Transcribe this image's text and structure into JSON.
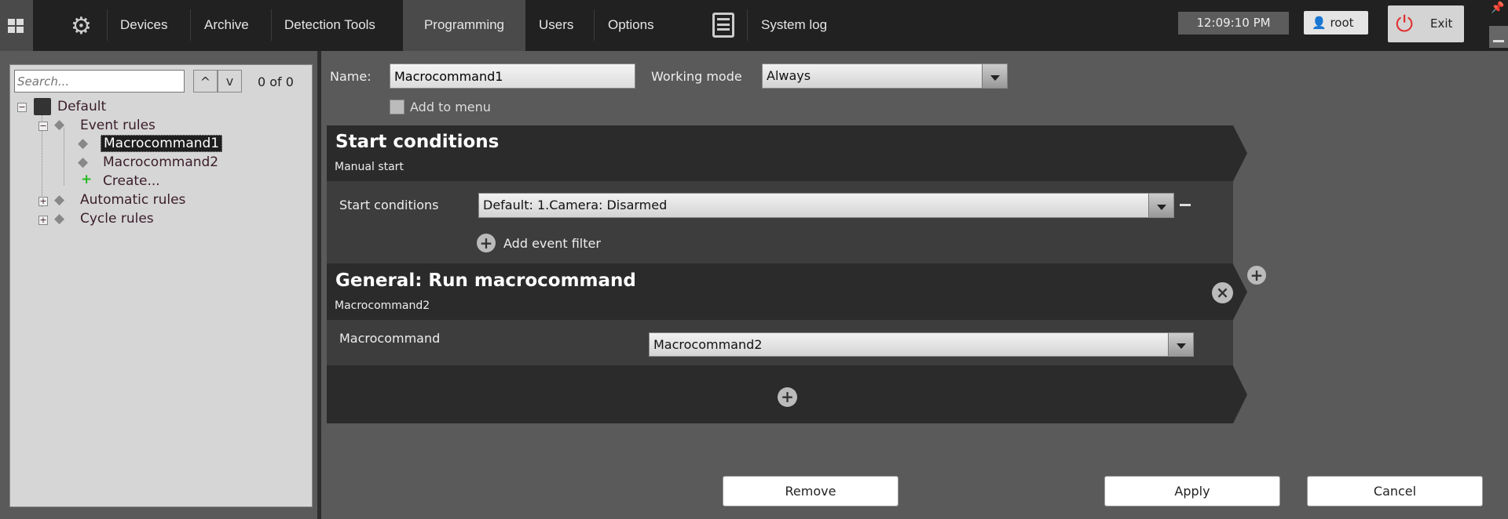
{
  "topbar": {
    "nav": [
      "Devices",
      "Archive",
      "Detection Tools",
      "Programming",
      "Users",
      "Options"
    ],
    "active": "Programming",
    "system_log": "System log",
    "clock": "12:09:10 PM",
    "user": "root",
    "exit": "Exit"
  },
  "tree": {
    "search_placeholder": "Search...",
    "counter": "0 of 0",
    "root": "Default",
    "event_rules": "Event rules",
    "items": [
      "Macrocommand1",
      "Macrocommand2"
    ],
    "create": "Create...",
    "automatic_rules": "Automatic rules",
    "cycle_rules": "Cycle rules"
  },
  "form": {
    "name_label": "Name:",
    "name_value": "Macrocommand1",
    "working_mode_label": "Working mode",
    "working_mode_value": "Always",
    "add_to_menu": "Add to menu"
  },
  "start": {
    "title": "Start conditions",
    "subtitle": "Manual start",
    "row_label": "Start conditions",
    "row_value": "Default: 1.Camera: Disarmed",
    "add_filter": "Add event filter"
  },
  "action": {
    "title": "General: Run macrocommand",
    "subtitle": "Macrocommand2",
    "row_label": "Macrocommand",
    "row_value": "Macrocommand2"
  },
  "buttons": {
    "remove": "Remove",
    "apply": "Apply",
    "cancel": "Cancel"
  },
  "colors": {
    "exit_icon": "#e03030",
    "create_plus": "#22bb22",
    "active_tab": "#4a4a4a"
  }
}
